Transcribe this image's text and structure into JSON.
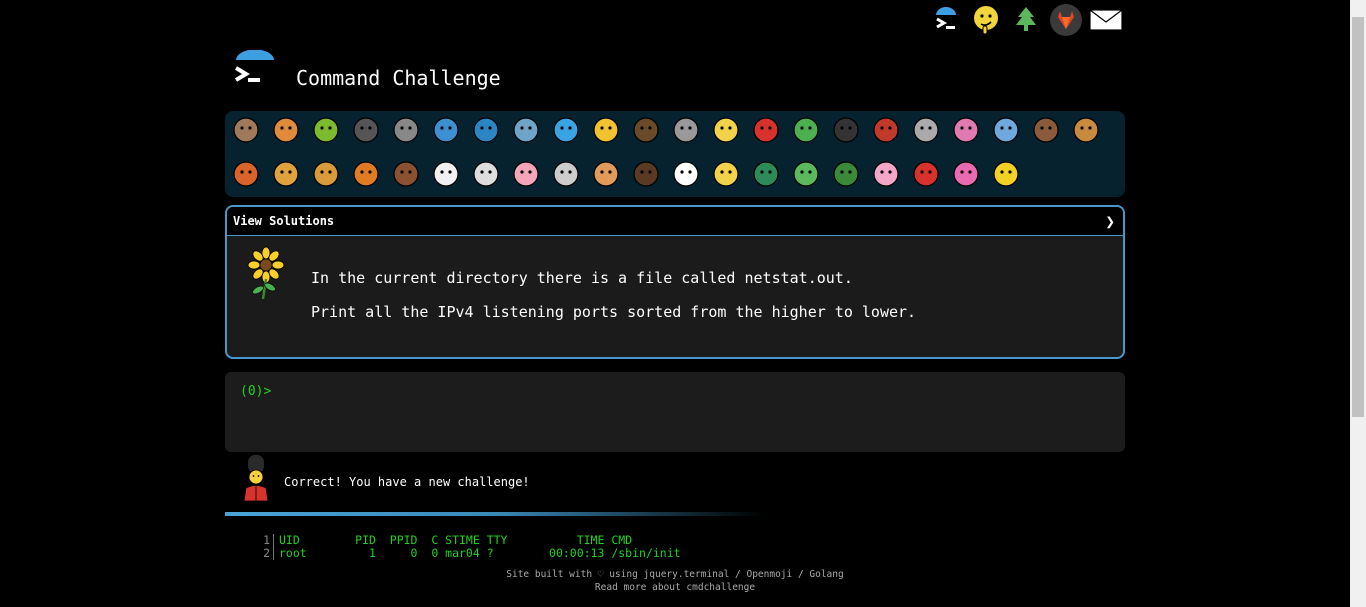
{
  "header": {
    "title": "Command Challenge",
    "top_icons": [
      "terminal-icon",
      "cathedral-ear-icon",
      "tree-icon",
      "gitlab-icon",
      "mail-icon"
    ]
  },
  "animals": [
    "snail",
    "butterfly",
    "caterpillar",
    "ant",
    "spiderweb",
    "whale",
    "dolphin",
    "shark",
    "fish",
    "tropical-fish",
    "turtle",
    "wolf",
    "bee",
    "ladybug",
    "lizard",
    "spider",
    "scorpion",
    "fly",
    "worm",
    "microbe",
    "monkey",
    "dog",
    "fox",
    "cat",
    "lion",
    "tiger",
    "horse",
    "unicorn",
    "cow",
    "pig",
    "mouse",
    "hamster",
    "bear",
    "panda",
    "hatching-chick",
    "peacock",
    "frog",
    "dragon",
    "cherry-blossom",
    "rose",
    "hibiscus",
    "sunflower"
  ],
  "solutions": {
    "label": "View Solutions",
    "toggle": "❯",
    "icon": "sunflower-icon"
  },
  "challenge": {
    "line1": "In the current directory there is a file called netstat.out.",
    "line2": "Print all the IPv4 listening ports sorted from the higher to lower."
  },
  "terminal": {
    "prompt": "(0)>"
  },
  "status": {
    "message": "Correct! You have a new challenge!"
  },
  "output": {
    "lines": [
      {
        "n": "1",
        "text": "UID        PID  PPID  C STIME TTY          TIME CMD"
      },
      {
        "n": "2",
        "text": "root         1     0  0 mar04 ?        00:00:13 /sbin/init"
      }
    ]
  },
  "footer": {
    "line1": "Site built with ♡ using jquery.terminal / Openmoji / Golang",
    "line2": "Read more about cmdchallenge"
  },
  "colors": {
    "background": "#000000",
    "panel": "#07222f",
    "accent": "#4a97c9",
    "terminal_green": "#22d022"
  }
}
